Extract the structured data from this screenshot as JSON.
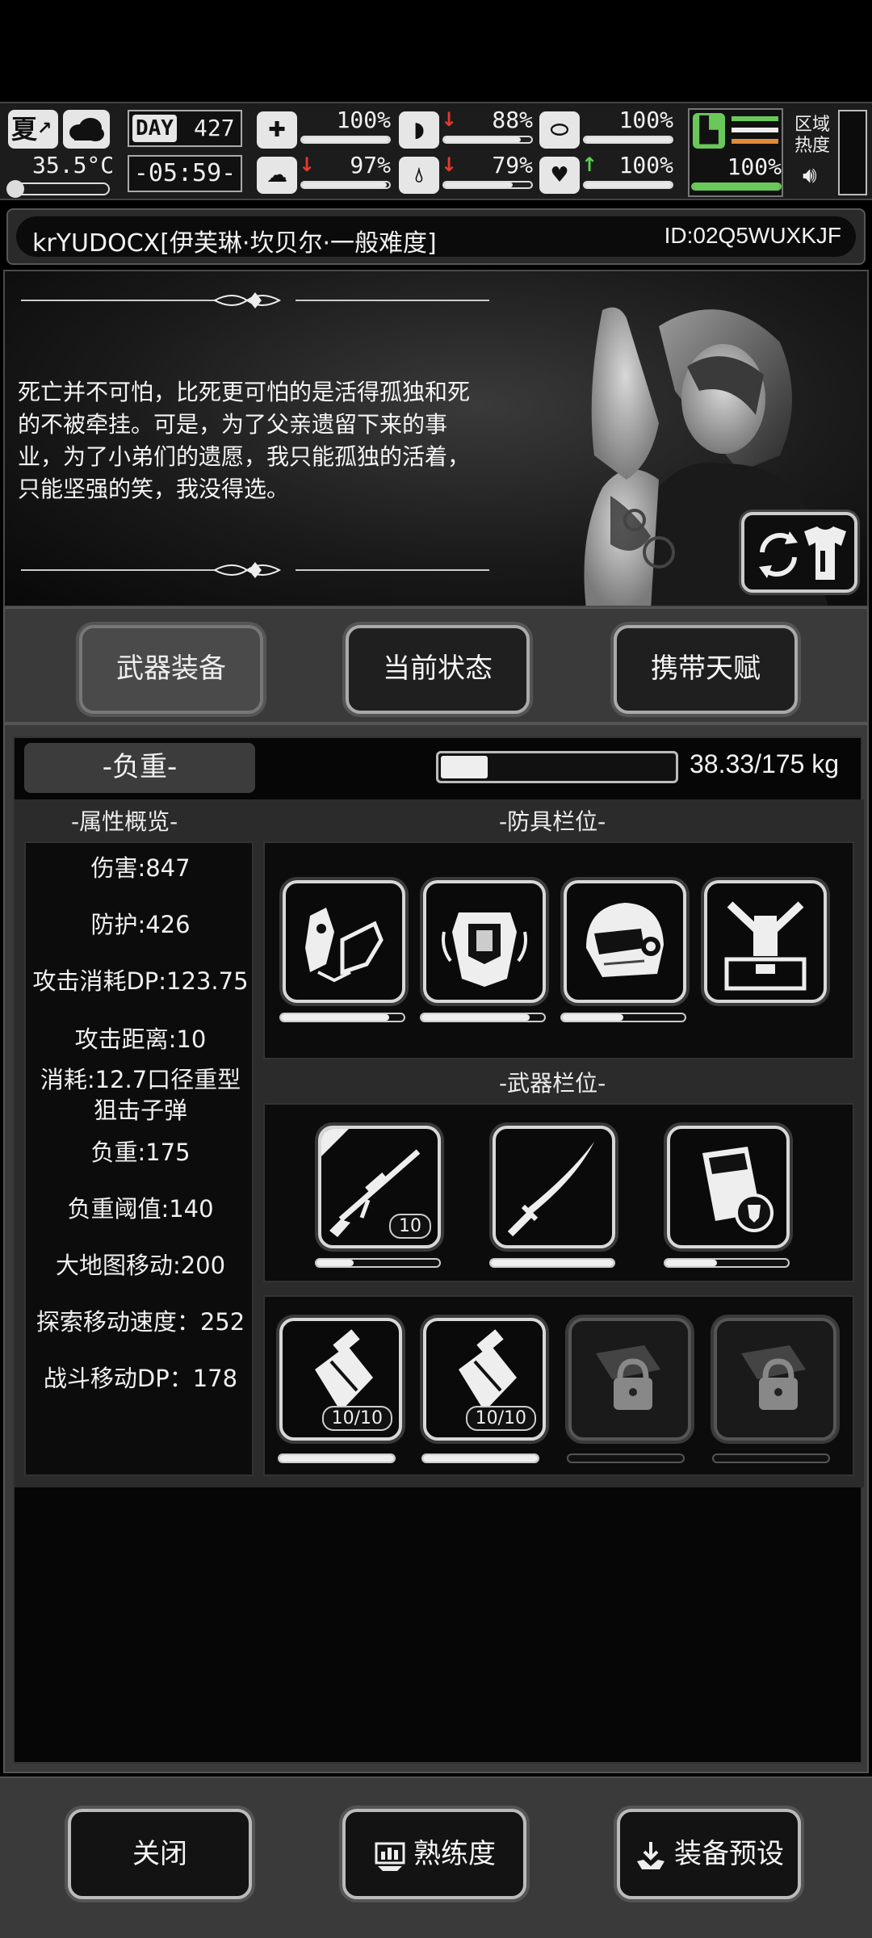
{
  "status": {
    "season": "夏",
    "temperature": "35.5°C",
    "day_label": "DAY",
    "day_value": "427",
    "clock": "-05:59-",
    "health": "100%",
    "hunger": "88%",
    "armor_cond": "100%",
    "stamina": "97%",
    "thirst": "79%",
    "heart": "100%",
    "boot": "100%",
    "area_heat_label": "区域热度",
    "levels": {
      "health": 1.0,
      "hunger": 0.88,
      "armor_cond": 1.0,
      "stamina": 0.97,
      "thirst": 0.79,
      "heart": 1.0,
      "boot": 1.0
    }
  },
  "character": {
    "name_line": "krYUDOCX[伊芙琳·坎贝尔·一般难度]",
    "id_line": "ID:02Q5WUXKJF",
    "quote": "死亡并不可怕，比死更可怕的是活得孤独和死的不被牵挂。可是，为了父亲遗留下来的事业，为了小弟们的遗愿，我只能孤独的活着，只能坚强的笑，我没得选。"
  },
  "tabs": [
    "武器装备",
    "当前状态",
    "携带天赋"
  ],
  "weight": {
    "label": "-负重-",
    "text": "38.33/175 kg",
    "fraction": 0.219
  },
  "sections": {
    "attributes": "-属性概览-",
    "armor": "-防具栏位-",
    "weapons": "-武器栏位-"
  },
  "attributes": [
    "伤害:847",
    "防护:426",
    "攻击消耗DP:123.75",
    "攻击距离:10",
    "消耗:12.7口径重型狙击子弹",
    "负重:175",
    "负重阈值:140",
    "大地图移动:200",
    "探索移动速度：252",
    "战斗移动DP：178"
  ],
  "armor_slots": [
    {
      "icon": "gloves-icon",
      "durability": 0.88
    },
    {
      "icon": "chest-armor-icon",
      "durability": 0.88
    },
    {
      "icon": "helmet-icon",
      "durability": 0.5
    },
    {
      "icon": "backpack-frame-icon",
      "durability": 0.0
    }
  ],
  "weapon_slots": [
    {
      "icon": "sniper-rifle-icon",
      "ammo": "10",
      "durability": 0.3
    },
    {
      "icon": "katana-icon",
      "durability": 1.0
    },
    {
      "icon": "shield-case-icon",
      "durability": 0.42
    }
  ],
  "item_slots": [
    {
      "icon": "injector-icon",
      "count": "10/10",
      "durability": 1.0
    },
    {
      "icon": "injector-icon",
      "count": "10/10",
      "durability": 1.0
    },
    {
      "icon": "lock-icon",
      "locked": true
    },
    {
      "icon": "lock-icon",
      "locked": true
    }
  ],
  "buttons": {
    "close": "关闭",
    "proficiency": "熟练度",
    "preset": "装备预设"
  }
}
